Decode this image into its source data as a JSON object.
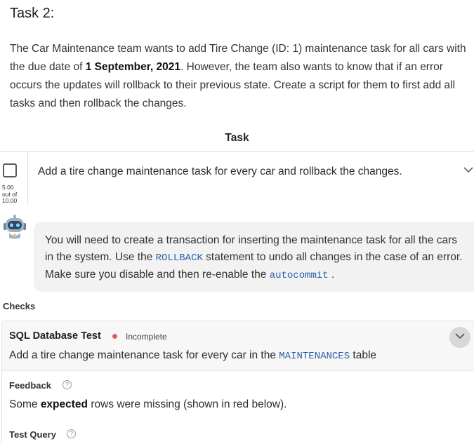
{
  "task_title": "Task 2:",
  "description": {
    "part1": "The Car Maintenance team wants to add Tire Change (ID: 1) maintenance task for all cars with the due date of ",
    "date_bold": "1 September, 2021",
    "part2": ". However, the team also wants to know that if an error occurs the updates will rollback to their previous state. Create a script for them to first add all tasks and then rollback the changes."
  },
  "task_header": "Task",
  "task_item": {
    "text": "Add a tire change maintenance task for every car and rollback the changes.",
    "score_line1": "5.00",
    "score_line2": "out of",
    "score_line3": "10.00"
  },
  "hint": {
    "part1": "You will need to create a transaction for inserting the maintenance task for all the cars in the system. Use the ",
    "code1": "ROLLBACK",
    "part2": " statement to undo all changes in the case of an error. Make sure you disable and then re-enable the ",
    "code2": "autocommit",
    "part3": " ."
  },
  "checks_label": "Checks",
  "check": {
    "title": "SQL Database Test",
    "status": "Incomplete",
    "status_color": "#e05c5c",
    "desc_part1": "Add a tire change maintenance task for every car in the ",
    "desc_code": "MAINTENANCES",
    "desc_part2": " table",
    "feedback_label": "Feedback",
    "feedback_part1": "Some ",
    "feedback_bold": "expected",
    "feedback_part2": " rows were missing (shown in red below).",
    "test_query_label": "Test Query",
    "help_glyph": "?"
  },
  "icons": {
    "chevron": "chevron-down-icon",
    "avatar": "robot-avatar-icon",
    "help": "question-circle-icon"
  }
}
